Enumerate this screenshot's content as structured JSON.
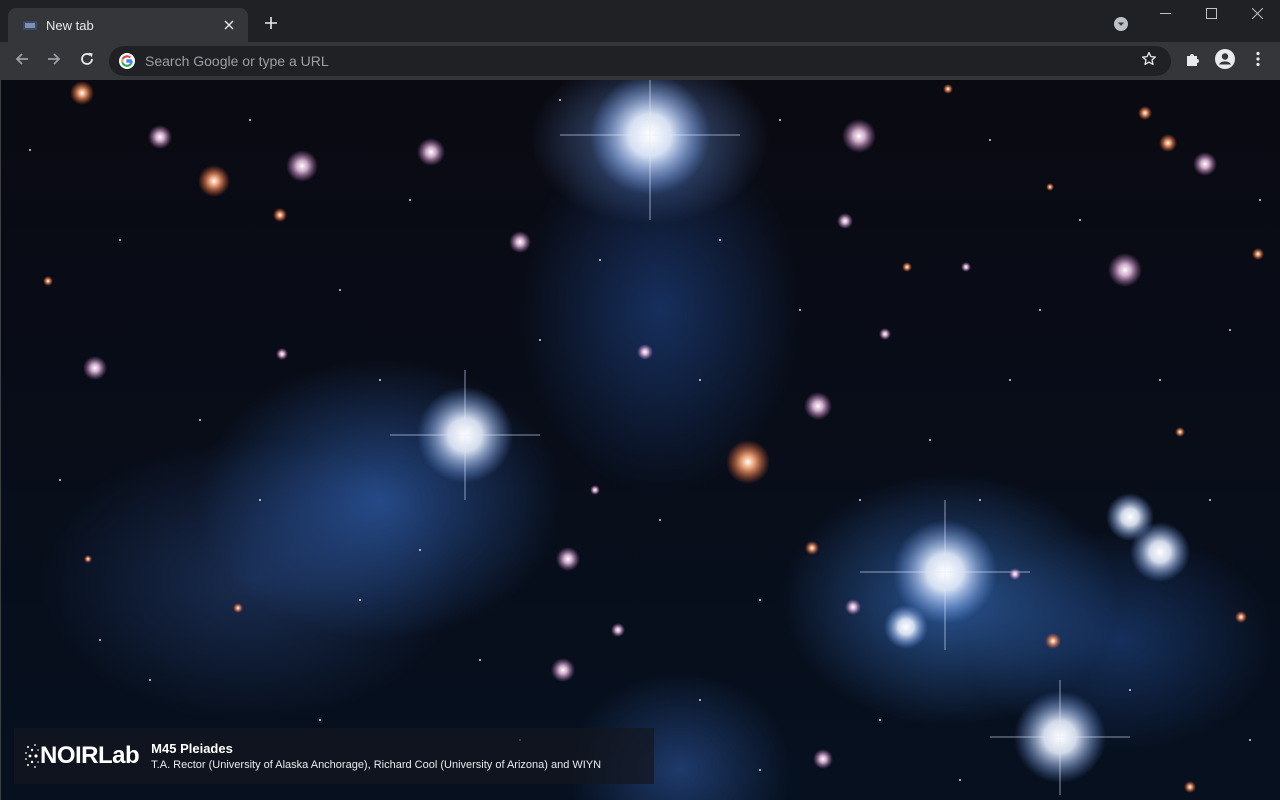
{
  "tabs": [
    {
      "title": "New tab",
      "active": true
    }
  ],
  "toolbar": {
    "omnibox_placeholder": "Search Google or type a URL",
    "omnibox_value": ""
  },
  "background": {
    "title": "M45 Pleiades",
    "credit": "T.A. Rector (University of Alaska Anchorage), Richard Cool (University of Arizona) and WIYN",
    "logo_text": "NOIRLab"
  },
  "icons": {
    "tab_favicon": "new-tab-favicon-icon",
    "tab_close": "close-icon",
    "new_tab": "plus-icon",
    "tab_search": "tab-search-icon",
    "minimize": "minimize-icon",
    "maximize": "maximize-icon",
    "close_window": "close-window-icon",
    "back": "back-arrow-icon",
    "forward": "forward-arrow-icon",
    "reload": "reload-icon",
    "google": "google-g-icon",
    "bookmark": "star-icon",
    "extensions": "puzzle-icon",
    "profile": "profile-icon",
    "menu": "kebab-menu-icon"
  },
  "colors": {
    "frame": "#202124",
    "toolbar": "#35363a",
    "omnibox": "#202124",
    "text": "#e8eaed",
    "icon": "#bdc1c6"
  }
}
